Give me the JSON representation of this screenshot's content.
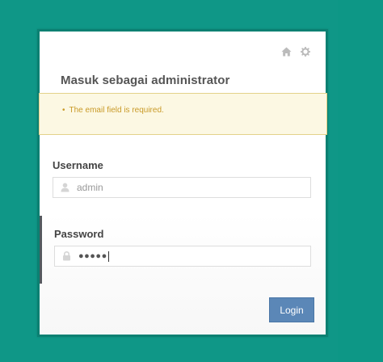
{
  "page": {
    "title": "Masuk sebagai administrator"
  },
  "alert": {
    "errors": [
      "The email field is required."
    ]
  },
  "username": {
    "label": "Username",
    "value": "admin"
  },
  "password": {
    "label": "Password",
    "masked_value": "●●●●●"
  },
  "actions": {
    "login_label": "Login"
  },
  "icons": {
    "home": "home-icon",
    "settings": "gear-icon",
    "user": "user-icon",
    "lock": "lock-icon"
  },
  "colors": {
    "background": "#0f9787",
    "alert_bg": "#fcf8e3",
    "alert_text": "#c99a28",
    "button": "#5b87b7"
  }
}
